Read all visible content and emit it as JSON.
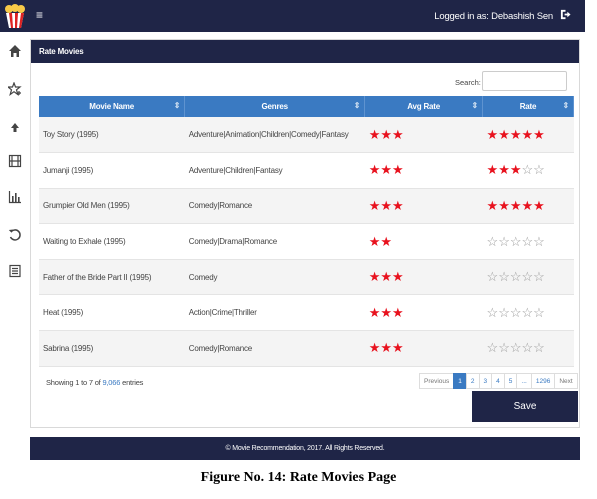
{
  "header": {
    "menu_glyph": "≡",
    "logged_in_text": "Logged in as: Debashish Sen",
    "icons": [
      "popcorn-logo-icon",
      "hamburger-icon",
      "logout-icon"
    ]
  },
  "sidebar": {
    "icons": [
      "home-icon",
      "star-rate-icon",
      "arrow-up-icon",
      "film-icon",
      "bar-chart-icon",
      "history-icon",
      "list-icon"
    ]
  },
  "panel": {
    "title": "Rate Movies",
    "search_label": "Search:",
    "search_value": ""
  },
  "table": {
    "columns": [
      "Movie Name",
      "Genres",
      "Avg Rate",
      "Rate"
    ],
    "rows": [
      {
        "name": "Toy Story (1995)",
        "genres": "Adventure|Animation|Children|Comedy|Fantasy",
        "avg_rate": 3,
        "rate": 5
      },
      {
        "name": "Jumanji (1995)",
        "genres": "Adventure|Children|Fantasy",
        "avg_rate": 3,
        "rate": 3
      },
      {
        "name": "Grumpier Old Men (1995)",
        "genres": "Comedy|Romance",
        "avg_rate": 3,
        "rate": 5
      },
      {
        "name": "Waiting to Exhale (1995)",
        "genres": "Comedy|Drama|Romance",
        "avg_rate": 2,
        "rate": 0
      },
      {
        "name": "Father of the Bride Part II (1995)",
        "genres": "Comedy",
        "avg_rate": 3,
        "rate": 0
      },
      {
        "name": "Heat (1995)",
        "genres": "Action|Crime|Thriller",
        "avg_rate": 3,
        "rate": 0
      },
      {
        "name": "Sabrina (1995)",
        "genres": "Comedy|Romance",
        "avg_rate": 3,
        "rate": 0
      }
    ],
    "max_rate": 5,
    "sort_glyph": "⇕"
  },
  "info": {
    "prefix": "Showing 1 to 7 of ",
    "total": "9,066",
    "suffix": " entries"
  },
  "pagination": {
    "items": [
      "Previous",
      "1",
      "2",
      "3",
      "4",
      "5",
      "...",
      "1296",
      "Next"
    ],
    "active": "1"
  },
  "save_label": "Save",
  "footer_text": "© Movie Recommendation, 2017. All Rights Reserved.",
  "caption": "Figure No. 14: Rate Movies Page",
  "colors": {
    "navy": "#1f2547",
    "table_header": "#3a7ac2",
    "star_filled": "#e8121e",
    "star_empty": "#9a9a9a"
  }
}
